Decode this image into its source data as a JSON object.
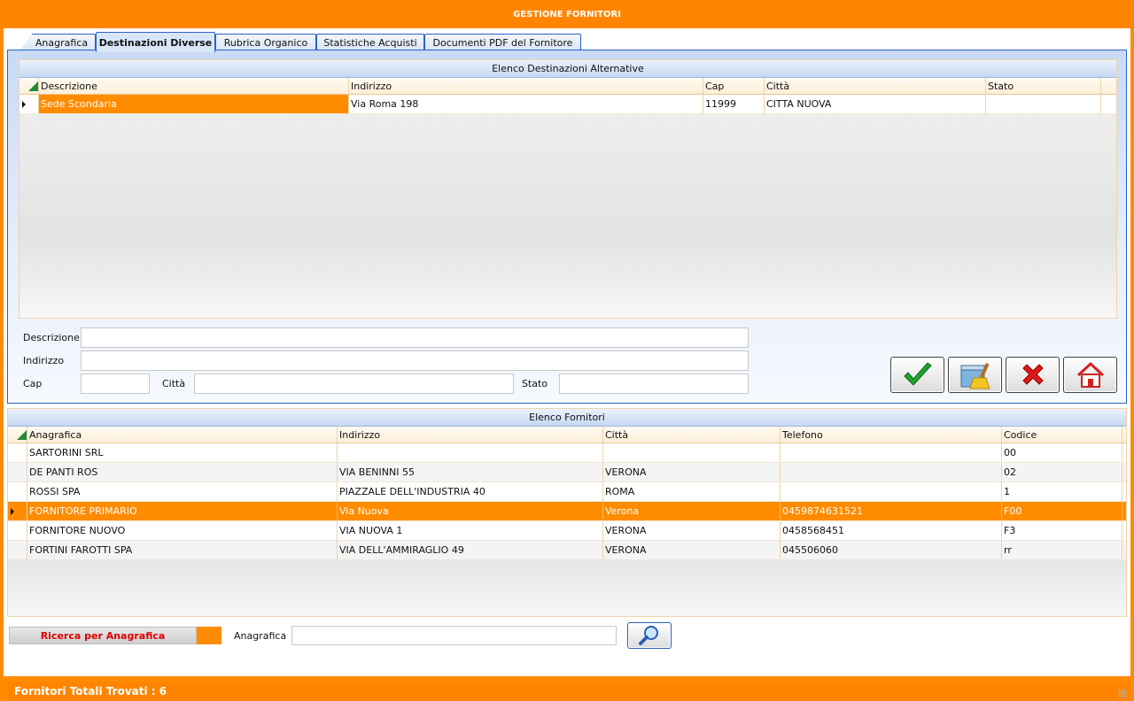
{
  "window": {
    "title": "GESTIONE FORNITORI"
  },
  "tabs": [
    {
      "label": "Anagrafica"
    },
    {
      "label": "Destinazioni Diverse",
      "active": true
    },
    {
      "label": "Rubrica Organico"
    },
    {
      "label": "Statistiche Acquisti"
    },
    {
      "label": "Documenti PDF del Fornitore"
    }
  ],
  "destinations": {
    "caption": "Elenco Destinazioni Alternative",
    "columns": [
      "Descrizione",
      "Indirizzo",
      "Cap",
      "Città",
      "Stato"
    ],
    "rows": [
      [
        "Sede Scondaria",
        "Via Roma 198",
        "11999",
        "CITTA NUOVA",
        ""
      ]
    ]
  },
  "form": {
    "descrizione_label": "Descrizione",
    "indirizzo_label": "Indirizzo",
    "cap_label": "Cap",
    "citta_label": "Città",
    "stato_label": "Stato",
    "descrizione_value": "",
    "indirizzo_value": "",
    "cap_value": "",
    "citta_value": "",
    "stato_value": ""
  },
  "buttons": {
    "confirm_icon": "check-icon",
    "clear_icon": "broom-icon",
    "cancel_icon": "x-icon",
    "home_icon": "home-icon"
  },
  "suppliers": {
    "caption": "Elenco Fornitori",
    "columns": [
      "Anagrafica",
      "Indirizzo",
      "Città",
      "Telefono",
      "Codice"
    ],
    "rows": [
      [
        "SARTORINI SRL",
        "",
        "",
        "",
        "00"
      ],
      [
        "DE PANTI ROS",
        "VIA BENINNI 55",
        "VERONA",
        "",
        "02"
      ],
      [
        "ROSSI SPA",
        "PIAZZALE DELL'INDUSTRIA 40",
        "ROMA",
        "",
        "1"
      ],
      [
        "FORNITORE PRIMARIO",
        "Via Nuova",
        "Verona",
        "0459874631521",
        "F00"
      ],
      [
        "FORNITORE NUOVO",
        "VIA NUOVA 1",
        "VERONA",
        "0458568451",
        "F3"
      ],
      [
        "FORTINI FAROTTI SPA",
        "VIA DELL'AMMIRAGLIO 49",
        "VERONA",
        "045506060",
        "rr"
      ]
    ],
    "selected_index": 3
  },
  "search": {
    "mode_label": "Ricerca per Anagrafica",
    "field_label": "Anagrafica",
    "field_value": ""
  },
  "status": {
    "text": "Fornitori Totali Trovati : 6"
  },
  "colors": {
    "accent": "#ff8500",
    "tab_border": "#2a62c9"
  }
}
